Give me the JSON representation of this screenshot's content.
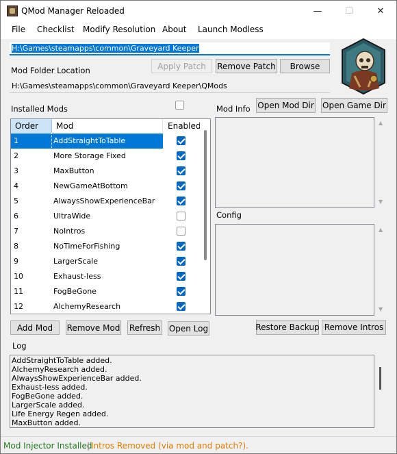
{
  "window": {
    "title": "QMod Manager Reloaded"
  },
  "controls": {
    "minimize": "—",
    "maximize": "☐",
    "close": "✕"
  },
  "menu": [
    "File",
    "Checklist",
    "Modify Resolution",
    "About",
    "Launch Modless"
  ],
  "game_path": "H:\\Games\\steamapps\\common\\Graveyard Keeper",
  "buttons": {
    "apply_patch": "Apply Patch",
    "remove_patch": "Remove Patch",
    "browse": "Browse",
    "open_mod_dir": "Open Mod Dir",
    "open_game_dir": "Open Game Dir",
    "add_mod": "Add Mod",
    "remove_mod": "Remove Mod",
    "refresh": "Refresh",
    "open_log": "Open Log",
    "restore_backup": "Restore Backup",
    "remove_intros": "Remove Intros"
  },
  "labels": {
    "mod_folder_location": "Mod Folder Location",
    "installed_mods": "Installed Mods",
    "mod_info": "Mod Info",
    "config": "Config",
    "log": "Log"
  },
  "mod_folder_path": "H:\\Games\\steamapps\\common\\Graveyard Keeper\\QMods",
  "grid": {
    "headers": {
      "order": "Order",
      "mod": "Mod",
      "enabled": "Enabled"
    },
    "rows": [
      {
        "order": "1",
        "mod": "AddStraightToTable",
        "enabled": true
      },
      {
        "order": "2",
        "mod": "More Storage Fixed",
        "enabled": true
      },
      {
        "order": "3",
        "mod": "MaxButton",
        "enabled": true
      },
      {
        "order": "4",
        "mod": "NewGameAtBottom",
        "enabled": true
      },
      {
        "order": "5",
        "mod": "AlwaysShowExperienceBar",
        "enabled": true
      },
      {
        "order": "6",
        "mod": "UltraWide",
        "enabled": false
      },
      {
        "order": "7",
        "mod": "NoIntros",
        "enabled": false
      },
      {
        "order": "8",
        "mod": "NoTimeForFishing",
        "enabled": true
      },
      {
        "order": "9",
        "mod": "LargerScale",
        "enabled": true
      },
      {
        "order": "10",
        "mod": "Exhaust-less",
        "enabled": true
      },
      {
        "order": "11",
        "mod": "FogBeGone",
        "enabled": true
      },
      {
        "order": "12",
        "mod": "AlchemyResearch",
        "enabled": true
      }
    ]
  },
  "log_lines": [
    "AddStraightToTable added.",
    "AlchemyResearch added.",
    "AlwaysShowExperienceBar added.",
    "Exhaust-less added.",
    "FogBeGone added.",
    "LargerScale added.",
    "Life Energy Regen added.",
    "MaxButton added."
  ],
  "status": {
    "injector": "Mod Injector Installed",
    "separator": "|",
    "intros": "Intros Removed (via mod and patch?)."
  },
  "colors": {
    "accent": "#0078d7",
    "status_ok": "#1f7a1f",
    "status_warn": "#e07c00"
  }
}
